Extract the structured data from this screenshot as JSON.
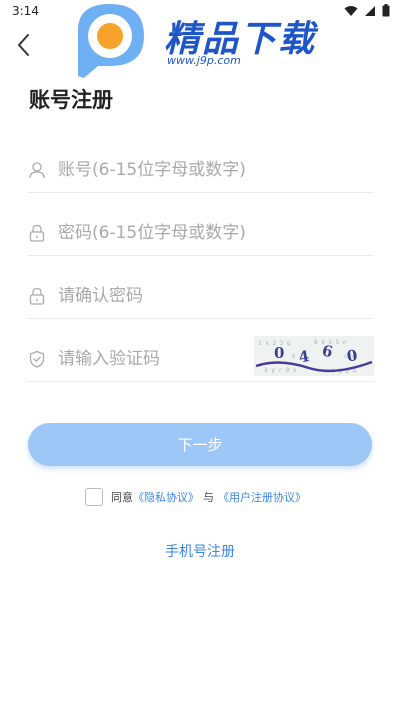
{
  "status_bar": {
    "time": "3:14"
  },
  "logo": {
    "text": "精品下载",
    "url": "www.j9p.com"
  },
  "page_title": "账号注册",
  "fields": {
    "account_placeholder": "账号(6-15位字母或数字)",
    "password_placeholder": "密码(6-15位字母或数字)",
    "confirm_placeholder": "请确认密码",
    "captcha_placeholder": "请输入验证码"
  },
  "captcha": {
    "code": "0460"
  },
  "next_button": "下一步",
  "agreement": {
    "prefix": "同意",
    "privacy": "《隐私协议》",
    "and": "与",
    "user_agreement": "《用户注册协议》"
  },
  "phone_register_link": "手机号注册",
  "colors": {
    "primary": "#3d86e6",
    "button": "#9dc7f7",
    "logo_blue": "#1f56c7",
    "logo_orange": "#f7a32b"
  }
}
